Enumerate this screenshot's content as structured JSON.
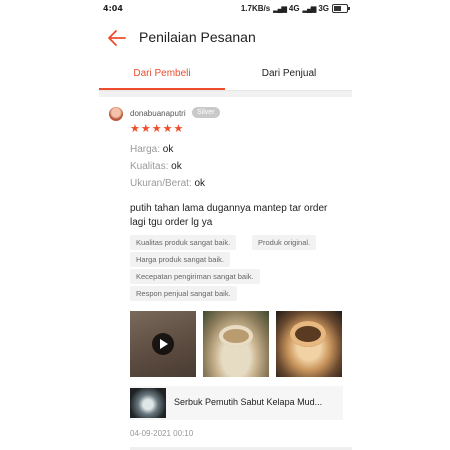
{
  "status_bar": {
    "time": "4:04",
    "speed": "1.7KB/s",
    "network_a": "4G",
    "network_b": "3G",
    "battery_level": 0.6
  },
  "header": {
    "title": "Penilaian Pesanan"
  },
  "tabs": [
    {
      "label": "Dari Pembeli",
      "active": true
    },
    {
      "label": "Dari Penjual",
      "active": false
    }
  ],
  "review": {
    "username": "donabuanaputri",
    "badge": "Silver",
    "rating": 5,
    "stars": "★★★★★",
    "attributes": [
      {
        "key": "Harga:",
        "value": "ok"
      },
      {
        "key": "Kualitas:",
        "value": "ok"
      },
      {
        "key": "Ukuran/Berat:",
        "value": "ok"
      }
    ],
    "comment": "putih tahan lama dugannya mantep tar order lagi tgu order lg ya",
    "tags": [
      "Kualitas produk sangat baik.",
      "Produk original.",
      "Harga produk sangat baik.",
      "Kecepatan pengiriman sangat baik.",
      "Respon penjual sangat baik."
    ],
    "product_name": "Serbuk Pemutih Sabut Kelapa Mud...",
    "date": "04-09-2021 00:10"
  },
  "colors": {
    "accent": "#ee4d2d",
    "badge": "#c9c9c9",
    "chip_bg": "#f2f2f2"
  }
}
